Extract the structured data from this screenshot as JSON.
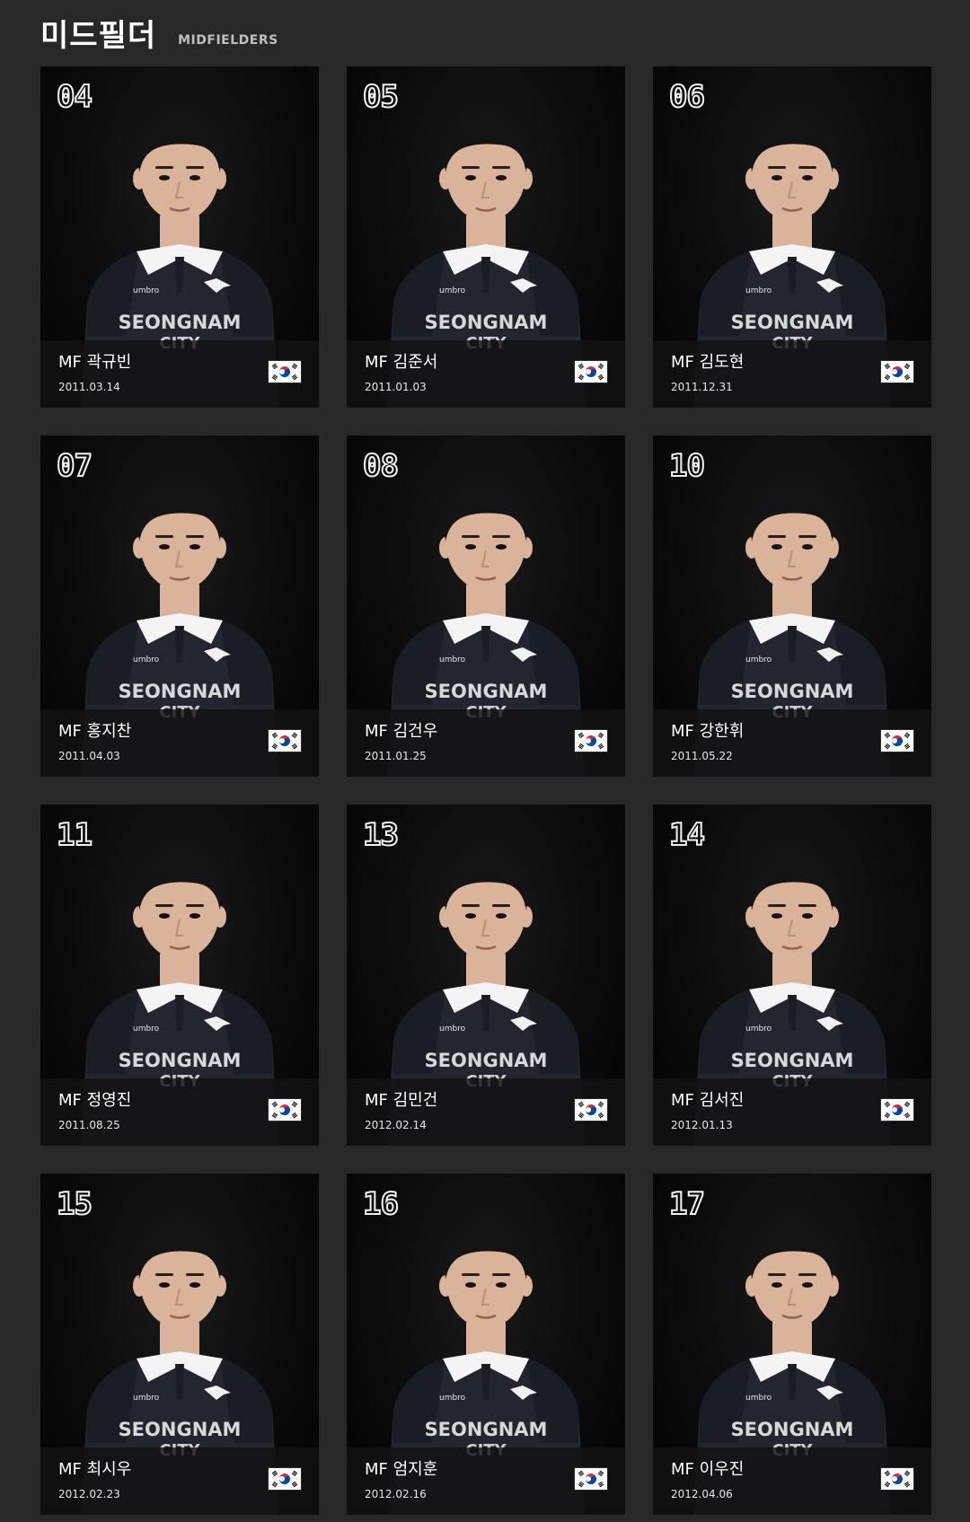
{
  "section": {
    "title": "미드필더",
    "subtitle": "MIDFIELDERS"
  },
  "players": [
    {
      "number": "04",
      "name": "MF 곽규빈",
      "dob": "2011.03.14",
      "flag": "korea-flag-icon"
    },
    {
      "number": "05",
      "name": "MF 김준서",
      "dob": "2011.01.03",
      "flag": "korea-flag-icon"
    },
    {
      "number": "06",
      "name": "MF 김도현",
      "dob": "2011.12.31",
      "flag": "korea-flag-icon"
    },
    {
      "number": "07",
      "name": "MF 홍지찬",
      "dob": "2011.04.03",
      "flag": "korea-flag-icon"
    },
    {
      "number": "08",
      "name": "MF 김건우",
      "dob": "2011.01.25",
      "flag": "korea-flag-icon"
    },
    {
      "number": "10",
      "name": "MF 강한휘",
      "dob": "2011.05.22",
      "flag": "korea-flag-icon"
    },
    {
      "number": "11",
      "name": "MF 정영진",
      "dob": "2011.08.25",
      "flag": "korea-flag-icon"
    },
    {
      "number": "13",
      "name": "MF 김민건",
      "dob": "2012.02.14",
      "flag": "korea-flag-icon"
    },
    {
      "number": "14",
      "name": "MF 김서진",
      "dob": "2012.01.13",
      "flag": "korea-flag-icon"
    },
    {
      "number": "15",
      "name": "MF 최시우",
      "dob": "2012.02.23",
      "flag": "korea-flag-icon"
    },
    {
      "number": "16",
      "name": "MF 엄지훈",
      "dob": "2012.02.16",
      "flag": "korea-flag-icon"
    },
    {
      "number": "17",
      "name": "MF 이우진",
      "dob": "2012.04.06",
      "flag": "korea-flag-icon"
    }
  ],
  "jersey": {
    "sponsor_text": "SEONGNAM",
    "city_text": "CITY",
    "brand_text": "umbro"
  },
  "colors": {
    "background": "#282828",
    "card": "#0b0b0b",
    "shirt": "#23252f",
    "collar": "#f4f4f4",
    "hair": "#141414",
    "skin": "#d9b49a"
  }
}
